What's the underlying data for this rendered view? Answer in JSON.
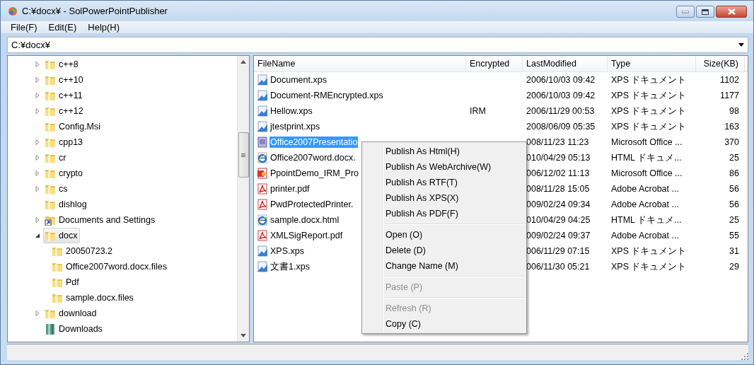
{
  "window": {
    "title": "C:¥docx¥ - SolPowerPointPublisher"
  },
  "menu_bar": [
    "File(F)",
    "Edit(E)",
    "Help(H)"
  ],
  "path_field": {
    "value": "C:¥docx¥"
  },
  "tree": [
    {
      "label": "c++8",
      "kind": "folder",
      "expandable": true,
      "expanded": false,
      "selected": false
    },
    {
      "label": "c++10",
      "kind": "folder",
      "expandable": true,
      "expanded": false,
      "selected": false
    },
    {
      "label": "c++11",
      "kind": "folder",
      "expandable": true,
      "expanded": false,
      "selected": false
    },
    {
      "label": "c++12",
      "kind": "folder",
      "expandable": true,
      "expanded": false,
      "selected": false
    },
    {
      "label": "Config.Msi",
      "kind": "folder",
      "expandable": false,
      "selected": false
    },
    {
      "label": "cpp13",
      "kind": "folder",
      "expandable": true,
      "expanded": false,
      "selected": false
    },
    {
      "label": "cr",
      "kind": "folder",
      "expandable": true,
      "expanded": false,
      "selected": false
    },
    {
      "label": "crypto",
      "kind": "folder",
      "expandable": true,
      "expanded": false,
      "selected": false
    },
    {
      "label": "cs",
      "kind": "folder",
      "expandable": true,
      "expanded": false,
      "selected": false
    },
    {
      "label": "dishlog",
      "kind": "folder",
      "expandable": false,
      "selected": false
    },
    {
      "label": "Documents and Settings",
      "kind": "shortcut",
      "expandable": true,
      "expanded": false,
      "selected": false
    },
    {
      "label": "docx",
      "kind": "folder",
      "expandable": true,
      "expanded": true,
      "selected": true,
      "children": [
        {
          "label": "20050723.2",
          "kind": "folder",
          "expandable": false,
          "selected": false
        },
        {
          "label": "Office2007word.docx.files",
          "kind": "folder",
          "expandable": false,
          "selected": false
        },
        {
          "label": "Pdf",
          "kind": "folder",
          "expandable": false,
          "selected": false
        },
        {
          "label": "sample.docx.files",
          "kind": "folder",
          "expandable": false,
          "selected": false
        }
      ]
    },
    {
      "label": "download",
      "kind": "folder",
      "expandable": true,
      "expanded": false,
      "selected": false
    },
    {
      "label": "Downloads",
      "kind": "library",
      "expandable": false,
      "selected": false
    }
  ],
  "table": {
    "columns": [
      "FileName",
      "Encrypted",
      "LastModified",
      "Type",
      "Size(KB)"
    ],
    "rows": [
      {
        "kind": "xps",
        "name": "Document.xps",
        "modified": "2006/10/03 09:42",
        "type": "XPS ドキュメント",
        "size": "1102",
        "selected": false
      },
      {
        "kind": "xps",
        "name": "Document-RMEncrypted.xps",
        "modified": "2006/10/03 09:42",
        "type": "XPS ドキュメント",
        "size": "1177",
        "selected": false
      },
      {
        "kind": "xps",
        "name": "Hellow.xps",
        "encrypted": "IRM",
        "modified": "2006/11/29 00:53",
        "type": "XPS ドキュメント",
        "size": "98",
        "selected": false
      },
      {
        "kind": "xps",
        "name": "jtestprint.xps",
        "modified": "2008/06/09 05:35",
        "type": "XPS ドキュメント",
        "size": "163",
        "selected": false
      },
      {
        "kind": "pptx",
        "name": "Office2007Presentatio",
        "modified": "008/11/23 11:23",
        "type": "Microsoft Office ...",
        "size": "370",
        "selected": true
      },
      {
        "kind": "html",
        "name": "Office2007word.docx.",
        "modified": "010/04/29 05:13",
        "type": "HTML ドキュメ...",
        "size": "25",
        "selected": false
      },
      {
        "kind": "ppt",
        "name": "PpointDemo_IRM_Pro",
        "modified": "006/12/02 11:13",
        "type": "Microsoft Office ...",
        "size": "86",
        "selected": false
      },
      {
        "kind": "pdf",
        "name": "printer.pdf",
        "modified": "008/11/28 15:05",
        "type": "Adobe Acrobat ...",
        "size": "56",
        "selected": false
      },
      {
        "kind": "pdf",
        "name": "PwdProtectedPrinter.",
        "modified": "009/02/24 09:34",
        "type": "Adobe Acrobat ...",
        "size": "56",
        "selected": false
      },
      {
        "kind": "html",
        "name": "sample.docx.html",
        "modified": "010/04/29 04:25",
        "type": "HTML ドキュメ...",
        "size": "25",
        "selected": false
      },
      {
        "kind": "pdf",
        "name": "XMLSigReport.pdf",
        "modified": "009/02/24 09:37",
        "type": "Adobe Acrobat ...",
        "size": "55",
        "selected": false
      },
      {
        "kind": "xps",
        "name": "XPS.xps",
        "modified": "006/11/29 07:15",
        "type": "XPS ドキュメント",
        "size": "31",
        "selected": false
      },
      {
        "kind": "xps",
        "name": "文書1.xps",
        "modified": "006/11/30 05:21",
        "type": "XPS ドキュメント",
        "size": "29",
        "selected": false
      }
    ]
  },
  "context_menu": {
    "groups": [
      [
        {
          "label": "Publish As Html(H)",
          "disabled": false
        },
        {
          "label": "Publish As WebArchive(W)",
          "disabled": false
        },
        {
          "label": "Publish As RTF(T)",
          "disabled": false
        },
        {
          "label": "Publish As XPS(X)",
          "disabled": false
        },
        {
          "label": "Publish As PDF(F)",
          "disabled": false
        }
      ],
      [
        {
          "label": "Open (O)",
          "disabled": false
        },
        {
          "label": "Delete (D)",
          "disabled": false
        },
        {
          "label": "Change Name (M)",
          "disabled": false
        }
      ],
      [
        {
          "label": "Paste (P)",
          "disabled": true
        }
      ],
      [
        {
          "label": "Refresh (R)",
          "disabled": true
        },
        {
          "label": "Copy (C)",
          "disabled": false
        }
      ]
    ]
  }
}
